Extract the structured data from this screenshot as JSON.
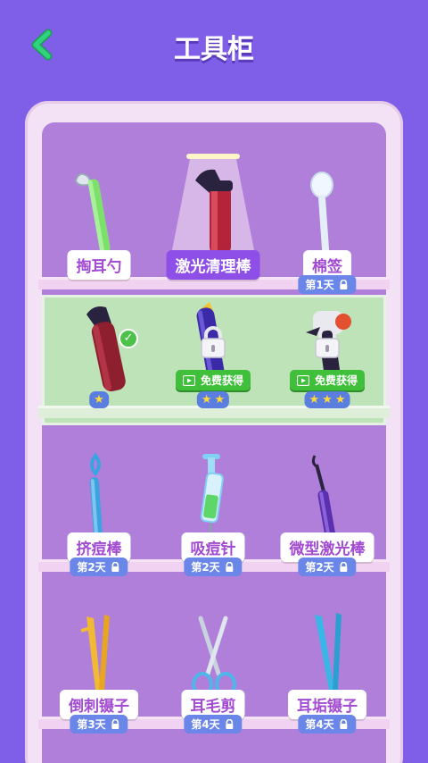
{
  "header": {
    "title": "工具柜",
    "back_icon": "chevron-left-icon",
    "accent_color": "#2fd37c"
  },
  "colors": {
    "background": "#7f5fe8",
    "cabinet_frame": "#f3e2f5",
    "cabinet_inner": "#b07fda",
    "selected_shelf": "#bfe3b8",
    "label_text": "#a24bd2",
    "active_label_bg": "#8e4fe8",
    "day_badge": "#6a86e8",
    "free_badge": "#3fbf3a"
  },
  "shelf1": {
    "items": [
      {
        "name": "掏耳勺",
        "icon": "ear-spoon-icon",
        "active": false
      },
      {
        "name": "激光清理棒",
        "icon": "laser-cleaner-icon",
        "active": true
      },
      {
        "name": "棉签",
        "icon": "cotton-swab-icon",
        "active": false,
        "unlock": "第1天"
      }
    ]
  },
  "shelf2": {
    "items": [
      {
        "icon": "hair-dryer-icon",
        "stars": 1,
        "selected": true
      },
      {
        "icon": "vacuum-tool-icon",
        "stars": 2,
        "locked": true,
        "unlock": "免费获得"
      },
      {
        "icon": "camera-tool-icon",
        "stars": 3,
        "locked": true,
        "unlock": "免费获得"
      }
    ]
  },
  "shelf3": {
    "items": [
      {
        "name": "挤痘棒",
        "icon": "acne-stick-icon",
        "unlock": "第2天"
      },
      {
        "name": "吸痘针",
        "icon": "syringe-icon",
        "unlock": "第2天"
      },
      {
        "name": "微型激光棒",
        "icon": "micro-laser-icon",
        "unlock": "第2天"
      }
    ]
  },
  "shelf4": {
    "items": [
      {
        "name": "倒刺镊子",
        "icon": "barb-tweezers-icon",
        "unlock": "第3天"
      },
      {
        "name": "耳毛剪",
        "icon": "scissors-icon",
        "unlock": "第4天"
      },
      {
        "name": "耳垢镊子",
        "icon": "earwax-tweezers-icon",
        "unlock": "第4天"
      }
    ]
  }
}
